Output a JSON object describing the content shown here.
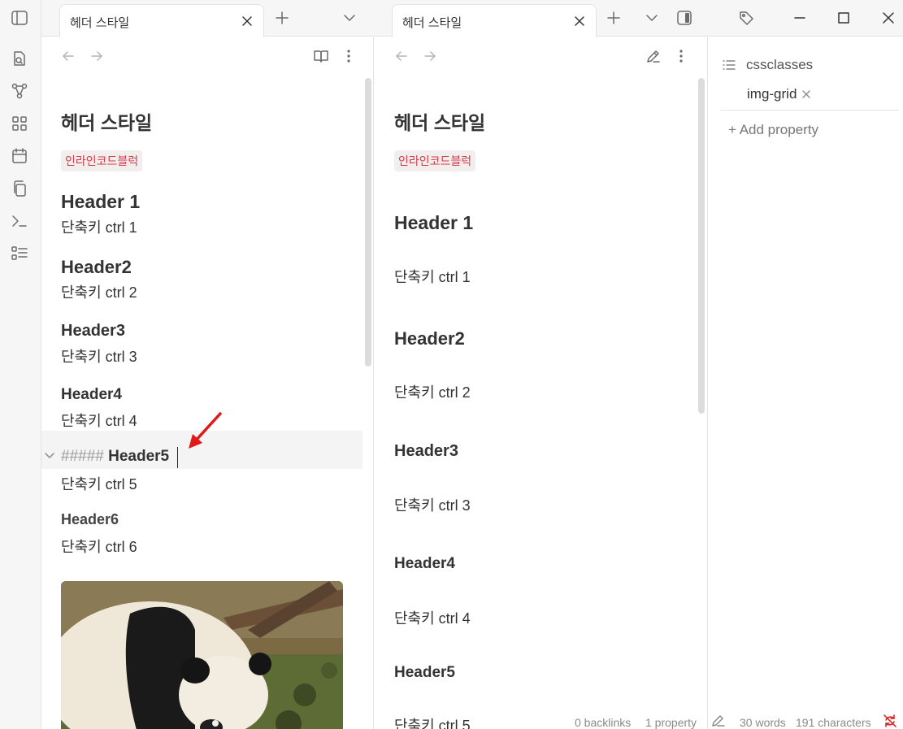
{
  "tabs": {
    "left": {
      "title": "헤더 스타일"
    },
    "right": {
      "title": "헤더 스타일"
    }
  },
  "left_note": {
    "title": "헤더 스타일",
    "inline_code": "인라인코드블럭",
    "h1": "Header 1",
    "h1_body": "단축키 ctrl 1",
    "h2": "Header2",
    "h2_body": "단축키 ctrl 2",
    "h3": "Header3",
    "h3_body": "단축키 ctrl 3",
    "h4": "Header4",
    "h4_body": "단축키 ctrl 4",
    "h5_marker": "#####",
    "h5": "Header5",
    "h5_body": "단축키 ctrl 5",
    "h6": "Header6",
    "h6_body": "단축키 ctrl 6"
  },
  "right_note": {
    "title": "헤더 스타일",
    "inline_code": "인라인코드블럭",
    "h1": "Header 1",
    "h1_body": "단축키 ctrl 1",
    "h2": "Header2",
    "h2_body": "단축키 ctrl 2",
    "h3": "Header3",
    "h3_body": "단축키 ctrl 3",
    "h4": "Header4",
    "h4_body": "단축키 ctrl 4",
    "h5": "Header5",
    "h5_body": "단축키 ctrl 5"
  },
  "properties": {
    "key": "cssclasses",
    "values": [
      "img-grid"
    ],
    "add_label": "+ Add property"
  },
  "status_bar": {
    "backlinks": "0 backlinks",
    "properties": "1 property",
    "words": "30 words",
    "characters": "191 characters"
  },
  "colors": {
    "inline_code_text": "#d13b4b",
    "arrow": "#e0191b",
    "sync_icon": "#e0191b"
  },
  "icons": {
    "ribbon": [
      "sidebar-toggle-icon",
      "search-file-icon",
      "graph-icon",
      "grid-icon",
      "calendar-icon",
      "copy-icon",
      "terminal-icon",
      "checklist-icon"
    ],
    "window": [
      "tag-icon",
      "minimize-icon",
      "maximize-icon",
      "close-window-icon"
    ]
  }
}
